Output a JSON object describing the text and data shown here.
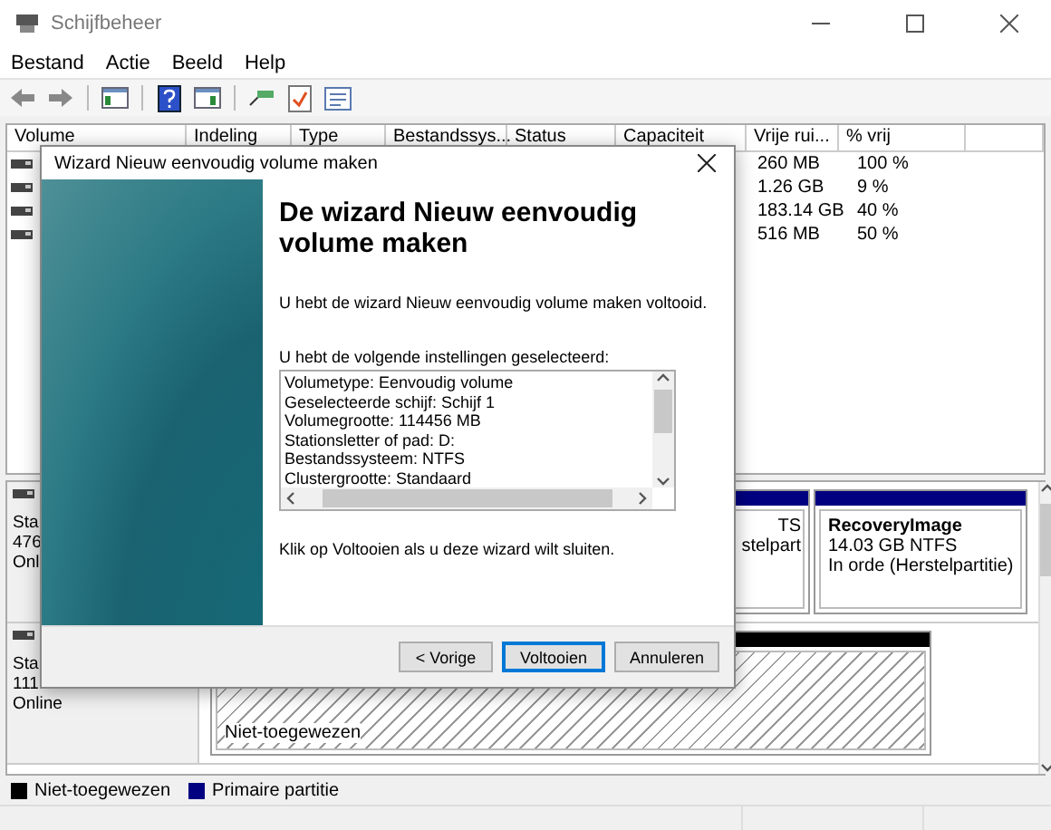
{
  "window": {
    "title": "Schijfbeheer"
  },
  "menu": [
    {
      "label": "Bestand"
    },
    {
      "label": "Actie"
    },
    {
      "label": "Beeld"
    },
    {
      "label": "Help"
    }
  ],
  "volume_table": {
    "columns": [
      "Volume",
      "Indeling",
      "Type",
      "Bestandssys...",
      "Status",
      "Capaciteit",
      "Vrije rui...",
      "% vrij"
    ],
    "rows": [
      {
        "free": "260 MB",
        "percent": "100 %"
      },
      {
        "free": "1.26 GB",
        "percent": "9 %"
      },
      {
        "free": "183.14 GB",
        "percent": "40 %"
      },
      {
        "free": "516 MB",
        "percent": "50 %"
      }
    ]
  },
  "disks": [
    {
      "label_lines": [
        "Sta",
        "476",
        "Onl"
      ],
      "partitions": [
        {
          "kind": "partial",
          "lines": [
            "TS",
            "stelpart"
          ]
        },
        {
          "kind": "primary",
          "name": "RecoveryImage",
          "lines": [
            "14.03 GB NTFS",
            "In orde (Herstelpartitie)"
          ]
        }
      ]
    },
    {
      "label_lines": [
        "Sta",
        "111",
        "Online"
      ],
      "partitions": [
        {
          "kind": "unallocated",
          "lines": [
            "Niet-toegewezen"
          ]
        }
      ]
    }
  ],
  "legend": [
    {
      "label": "Niet-toegewezen",
      "color": "#000000"
    },
    {
      "label": "Primaire partitie",
      "color": "#000080"
    }
  ],
  "dialog": {
    "title": "Wizard Nieuw eenvoudig volume maken",
    "heading": "De wizard Nieuw eenvoudig volume maken",
    "intro": "U hebt de wizard Nieuw eenvoudig volume maken voltooid.",
    "settings_label": "U hebt de volgende instellingen geselecteerd:",
    "settings": [
      "Volumetype: Eenvoudig volume",
      "Geselecteerde schijf: Schijf 1",
      "Volumegrootte: 114456 MB",
      "Stationsletter of pad: D:",
      "Bestandssysteem: NTFS",
      "Clustergrootte: Standaard"
    ],
    "closing": "Klik op Voltooien als u deze wizard wilt sluiten.",
    "buttons": [
      {
        "label": "< Vorige",
        "default": false
      },
      {
        "label": "Voltooien",
        "default": true
      },
      {
        "label": "Annuleren",
        "default": false
      }
    ]
  }
}
